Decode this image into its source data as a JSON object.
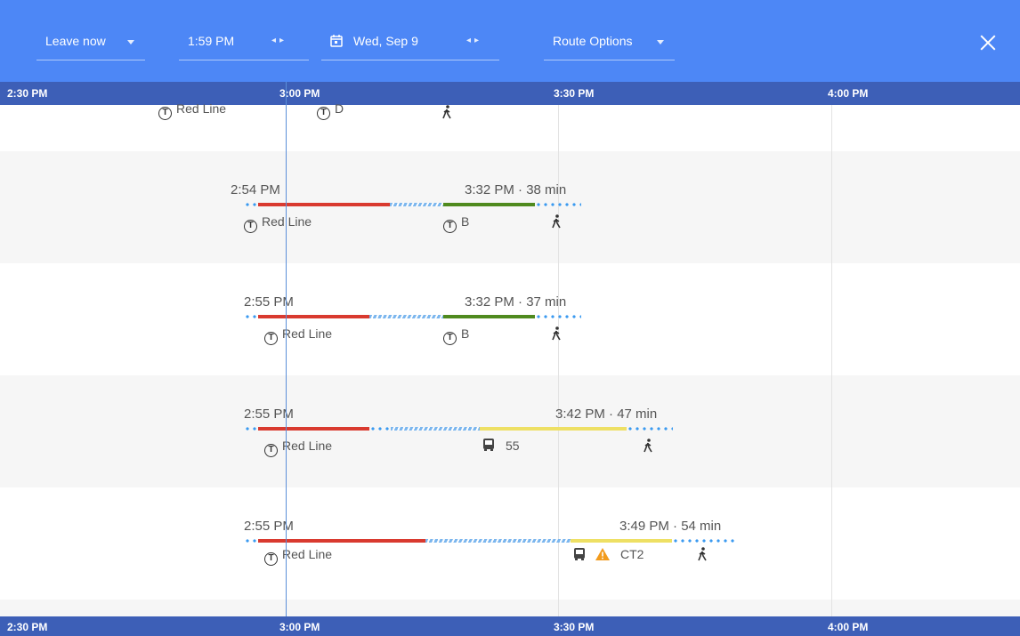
{
  "header": {
    "leave_label": "Leave now",
    "time_value": "1:59 PM",
    "date_value": "Wed, Sep 9",
    "route_options_label": "Route Options"
  },
  "timeline": {
    "ticks": [
      "2:30 PM",
      "3:00 PM",
      "3:30 PM",
      "4:00 PM"
    ]
  },
  "routes": [
    {
      "depart": "",
      "summary": "",
      "lines": [
        "Red Line",
        "D"
      ]
    },
    {
      "depart": "2:54 PM",
      "summary": "3:32 PM · 38 min",
      "lines": [
        "Red Line",
        "B"
      ]
    },
    {
      "depart": "2:55 PM",
      "summary": "3:32 PM · 37 min",
      "lines": [
        "Red Line",
        "B"
      ]
    },
    {
      "depart": "2:55 PM",
      "summary": "3:42 PM · 47 min",
      "lines": [
        "Red Line",
        "55"
      ]
    },
    {
      "depart": "2:55 PM",
      "summary": "3:49 PM · 54 min",
      "lines": [
        "Red Line",
        "CT2"
      ]
    }
  ],
  "colors": {
    "header": "#4d87f6",
    "timebar": "#3d5fb7",
    "red_line": "#d93a2f",
    "green_line": "#4f8a1e",
    "bus": "#eee064",
    "walk": "#3a9af0",
    "alert": "#f29b1d"
  },
  "icons": {
    "transit": "t-transit-icon",
    "bus": "bus-icon",
    "walk": "walk-icon",
    "alert": "warning-icon",
    "calendar": "calendar-icon",
    "close": "close-icon"
  }
}
